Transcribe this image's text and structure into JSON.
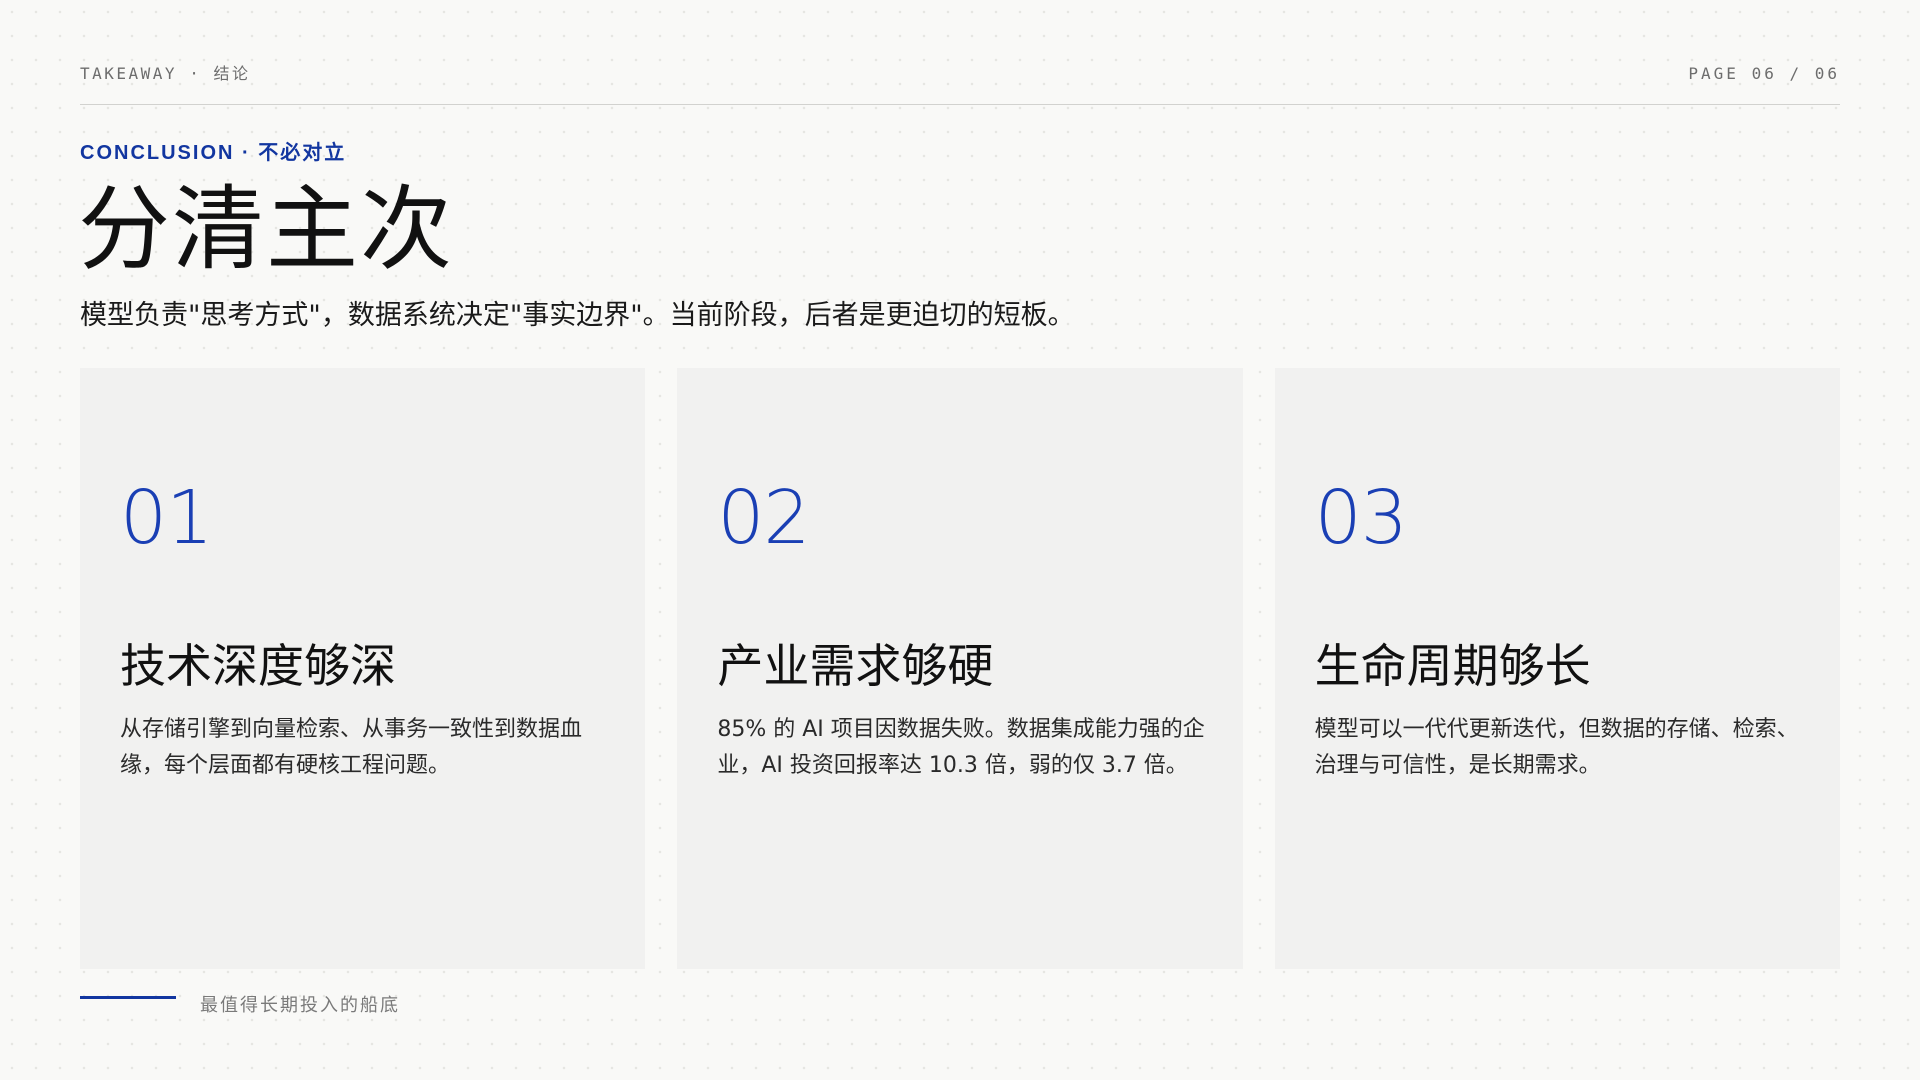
{
  "header": {
    "section_label": "TAKEAWAY · 结论",
    "page_indicator": "PAGE 06 / 06"
  },
  "title_block": {
    "eyebrow": "CONCLUSION · 不必对立",
    "title": "分清主次",
    "subtitle": "模型负责\"思考方式\"，数据系统决定\"事实边界\"。当前阶段，后者是更迫切的短板。"
  },
  "cards": [
    {
      "number": "01",
      "title": "技术深度够深",
      "body": "从存储引擎到向量检索、从事务一致性到数据血缘，每个层面都有硬核工程问题。"
    },
    {
      "number": "02",
      "title": "产业需求够硬",
      "body": "85% 的 AI 项目因数据失败。数据集成能力强的企业，AI 投资回报率达 10.3 倍，弱的仅 3.7 倍。"
    },
    {
      "number": "03",
      "title": "生命周期够长",
      "body": "模型可以一代代更新迭代，但数据的存储、检索、治理与可信性，是长期需求。"
    }
  ],
  "footer": {
    "caption": "最值得长期投入的船底"
  },
  "colors": {
    "accent": "#1236a0",
    "background": "#f9f9f7",
    "card_background": "#f1f1f0",
    "text": "#111111",
    "muted": "#6d6d6d"
  }
}
